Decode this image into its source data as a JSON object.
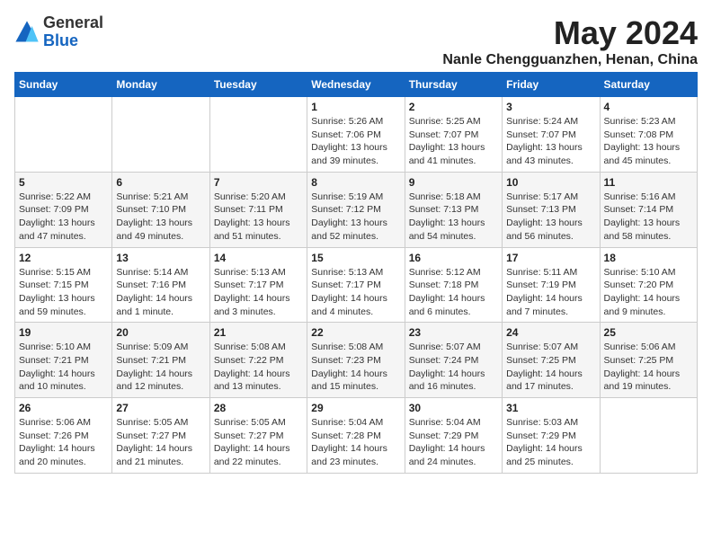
{
  "header": {
    "logo_general": "General",
    "logo_blue": "Blue",
    "month_title": "May 2024",
    "location": "Nanle Chengguanzhen, Henan, China"
  },
  "days_of_week": [
    "Sunday",
    "Monday",
    "Tuesday",
    "Wednesday",
    "Thursday",
    "Friday",
    "Saturday"
  ],
  "weeks": [
    [
      {
        "day": "",
        "info": ""
      },
      {
        "day": "",
        "info": ""
      },
      {
        "day": "",
        "info": ""
      },
      {
        "day": "1",
        "info": "Sunrise: 5:26 AM\nSunset: 7:06 PM\nDaylight: 13 hours\nand 39 minutes."
      },
      {
        "day": "2",
        "info": "Sunrise: 5:25 AM\nSunset: 7:07 PM\nDaylight: 13 hours\nand 41 minutes."
      },
      {
        "day": "3",
        "info": "Sunrise: 5:24 AM\nSunset: 7:07 PM\nDaylight: 13 hours\nand 43 minutes."
      },
      {
        "day": "4",
        "info": "Sunrise: 5:23 AM\nSunset: 7:08 PM\nDaylight: 13 hours\nand 45 minutes."
      }
    ],
    [
      {
        "day": "5",
        "info": "Sunrise: 5:22 AM\nSunset: 7:09 PM\nDaylight: 13 hours\nand 47 minutes."
      },
      {
        "day": "6",
        "info": "Sunrise: 5:21 AM\nSunset: 7:10 PM\nDaylight: 13 hours\nand 49 minutes."
      },
      {
        "day": "7",
        "info": "Sunrise: 5:20 AM\nSunset: 7:11 PM\nDaylight: 13 hours\nand 51 minutes."
      },
      {
        "day": "8",
        "info": "Sunrise: 5:19 AM\nSunset: 7:12 PM\nDaylight: 13 hours\nand 52 minutes."
      },
      {
        "day": "9",
        "info": "Sunrise: 5:18 AM\nSunset: 7:13 PM\nDaylight: 13 hours\nand 54 minutes."
      },
      {
        "day": "10",
        "info": "Sunrise: 5:17 AM\nSunset: 7:13 PM\nDaylight: 13 hours\nand 56 minutes."
      },
      {
        "day": "11",
        "info": "Sunrise: 5:16 AM\nSunset: 7:14 PM\nDaylight: 13 hours\nand 58 minutes."
      }
    ],
    [
      {
        "day": "12",
        "info": "Sunrise: 5:15 AM\nSunset: 7:15 PM\nDaylight: 13 hours\nand 59 minutes."
      },
      {
        "day": "13",
        "info": "Sunrise: 5:14 AM\nSunset: 7:16 PM\nDaylight: 14 hours\nand 1 minute."
      },
      {
        "day": "14",
        "info": "Sunrise: 5:13 AM\nSunset: 7:17 PM\nDaylight: 14 hours\nand 3 minutes."
      },
      {
        "day": "15",
        "info": "Sunrise: 5:13 AM\nSunset: 7:17 PM\nDaylight: 14 hours\nand 4 minutes."
      },
      {
        "day": "16",
        "info": "Sunrise: 5:12 AM\nSunset: 7:18 PM\nDaylight: 14 hours\nand 6 minutes."
      },
      {
        "day": "17",
        "info": "Sunrise: 5:11 AM\nSunset: 7:19 PM\nDaylight: 14 hours\nand 7 minutes."
      },
      {
        "day": "18",
        "info": "Sunrise: 5:10 AM\nSunset: 7:20 PM\nDaylight: 14 hours\nand 9 minutes."
      }
    ],
    [
      {
        "day": "19",
        "info": "Sunrise: 5:10 AM\nSunset: 7:21 PM\nDaylight: 14 hours\nand 10 minutes."
      },
      {
        "day": "20",
        "info": "Sunrise: 5:09 AM\nSunset: 7:21 PM\nDaylight: 14 hours\nand 12 minutes."
      },
      {
        "day": "21",
        "info": "Sunrise: 5:08 AM\nSunset: 7:22 PM\nDaylight: 14 hours\nand 13 minutes."
      },
      {
        "day": "22",
        "info": "Sunrise: 5:08 AM\nSunset: 7:23 PM\nDaylight: 14 hours\nand 15 minutes."
      },
      {
        "day": "23",
        "info": "Sunrise: 5:07 AM\nSunset: 7:24 PM\nDaylight: 14 hours\nand 16 minutes."
      },
      {
        "day": "24",
        "info": "Sunrise: 5:07 AM\nSunset: 7:25 PM\nDaylight: 14 hours\nand 17 minutes."
      },
      {
        "day": "25",
        "info": "Sunrise: 5:06 AM\nSunset: 7:25 PM\nDaylight: 14 hours\nand 19 minutes."
      }
    ],
    [
      {
        "day": "26",
        "info": "Sunrise: 5:06 AM\nSunset: 7:26 PM\nDaylight: 14 hours\nand 20 minutes."
      },
      {
        "day": "27",
        "info": "Sunrise: 5:05 AM\nSunset: 7:27 PM\nDaylight: 14 hours\nand 21 minutes."
      },
      {
        "day": "28",
        "info": "Sunrise: 5:05 AM\nSunset: 7:27 PM\nDaylight: 14 hours\nand 22 minutes."
      },
      {
        "day": "29",
        "info": "Sunrise: 5:04 AM\nSunset: 7:28 PM\nDaylight: 14 hours\nand 23 minutes."
      },
      {
        "day": "30",
        "info": "Sunrise: 5:04 AM\nSunset: 7:29 PM\nDaylight: 14 hours\nand 24 minutes."
      },
      {
        "day": "31",
        "info": "Sunrise: 5:03 AM\nSunset: 7:29 PM\nDaylight: 14 hours\nand 25 minutes."
      },
      {
        "day": "",
        "info": ""
      }
    ]
  ]
}
